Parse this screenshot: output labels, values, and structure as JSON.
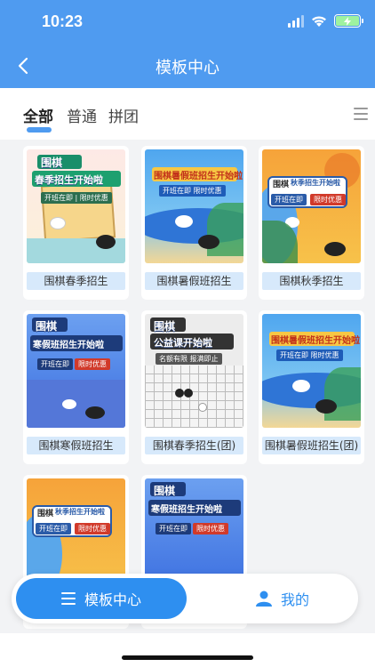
{
  "status_bar": {
    "time": "10:23"
  },
  "nav": {
    "title": "模板中心"
  },
  "tabs": [
    {
      "label": "全部",
      "active": true
    },
    {
      "label": "普通",
      "active": false
    },
    {
      "label": "拼团",
      "active": false
    }
  ],
  "templates": [
    {
      "label": "围棋春季招生",
      "thumb": {
        "line1": "围棋",
        "line2": "春季招生开始啦",
        "tag1": "开班在即",
        "tag2": "限时优惠"
      }
    },
    {
      "label": "围棋暑假班招生",
      "thumb": {
        "line1": "围棋暑假班招生开始啦",
        "tag1": "开班在即",
        "tag2": "限时优惠"
      }
    },
    {
      "label": "围棋秋季招生",
      "thumb": {
        "line1": "围棋",
        "line2": "秋季招生开始啦",
        "tag1": "开班在即",
        "tag2": "限时优惠"
      }
    },
    {
      "label": "围棋寒假班招生",
      "thumb": {
        "line1": "围棋",
        "line2": "寒假班招生开始啦",
        "tag1": "开班在即",
        "tag2": "限时优惠"
      }
    },
    {
      "label": "围棋春季招生(团)",
      "thumb": {
        "line1": "围棋",
        "line2": "公益课开始啦",
        "tag1": "名额有限",
        "tag2": "报满即止"
      }
    },
    {
      "label": "围棋暑假班招生(团)",
      "thumb": {
        "line1": "围棋暑假班招生开始啦",
        "tag1": "开班在即",
        "tag2": "限时优惠"
      }
    },
    {
      "label": "",
      "thumb": {
        "line1": "围棋",
        "line2": "秋季招生开始啦",
        "tag1": "开班在即",
        "tag2": "限时优惠"
      }
    },
    {
      "label": "",
      "thumb": {
        "line1": "围棋",
        "line2": "寒假班招生开始啦",
        "tag1": "开班在即",
        "tag2": "限时优惠"
      }
    }
  ],
  "bottom_nav": {
    "home_label": "模板中心",
    "mine_label": "我的"
  },
  "colors": {
    "accent": "#2e8ff0",
    "header": "#4f9bf0"
  }
}
